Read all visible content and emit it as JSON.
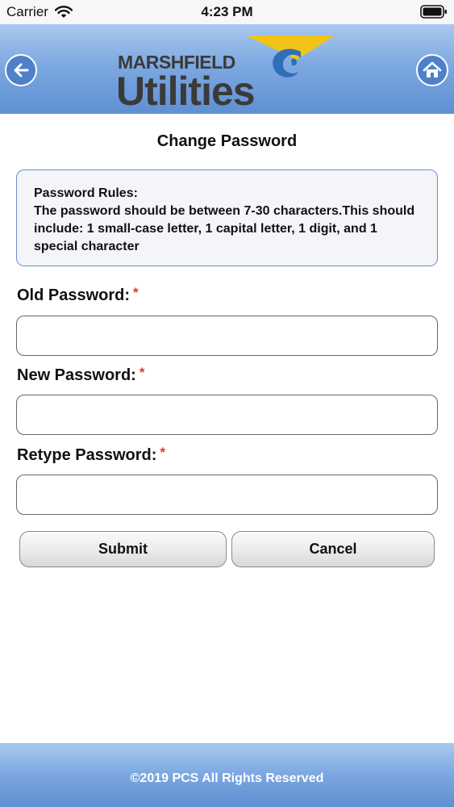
{
  "status_bar": {
    "carrier": "Carrier",
    "time": "4:23 PM"
  },
  "header": {
    "logo_line1": "MARSHFIELD",
    "logo_line2": "Utilities",
    "back_icon": "arrow-left-icon",
    "home_icon": "home-icon",
    "colors": {
      "header_gradient_top": "#a9c8ee",
      "header_gradient_bottom": "#5e8fd3",
      "logo_text": "#3a3a3a",
      "logo_accent_yellow": "#f2c417",
      "logo_accent_blue": "#2f6fb8"
    }
  },
  "page": {
    "title": "Change Password"
  },
  "rules": {
    "title": "Password Rules:",
    "text": "The password should be between 7-30 characters.This should include: 1 small-case letter, 1 capital letter, 1 digit, and 1 special character"
  },
  "form": {
    "old_password": {
      "label": "Old Password:",
      "required_marker": "*",
      "value": ""
    },
    "new_password": {
      "label": "New Password:",
      "required_marker": "*",
      "value": ""
    },
    "retype_password": {
      "label": "Retype Password:",
      "required_marker": "*",
      "value": ""
    },
    "submit_label": "Submit",
    "cancel_label": "Cancel"
  },
  "footer": {
    "copyright": "©2019 PCS All Rights Reserved"
  }
}
